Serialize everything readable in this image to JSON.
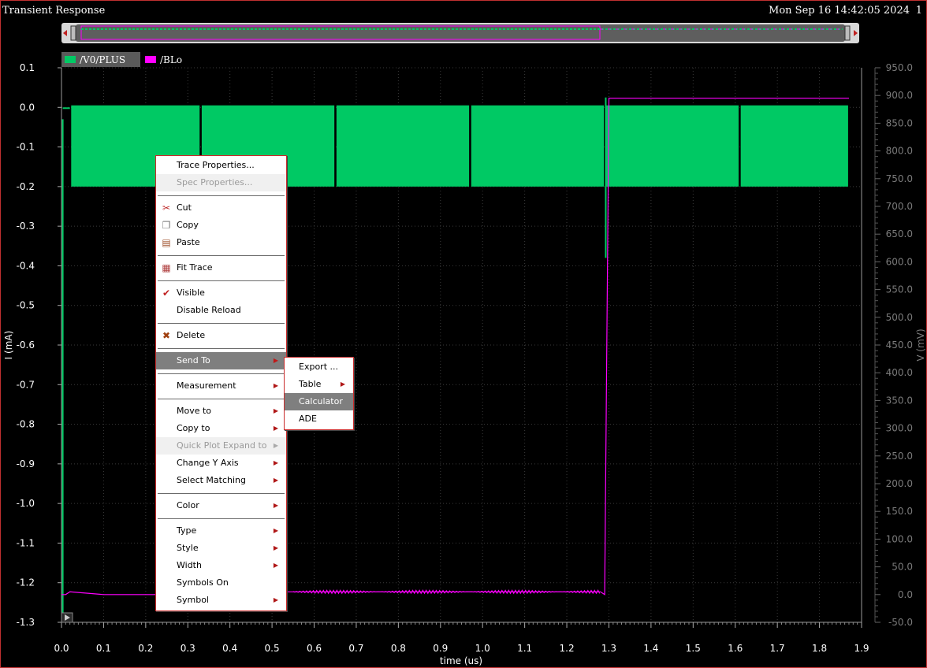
{
  "window": {
    "title": "Transient Response",
    "timestamp": "Mon Sep 16 14:42:05 2024",
    "page_number": "1"
  },
  "legend": [
    {
      "label": "/V0/PLUS",
      "color": "#00c964"
    },
    {
      "label": "/BLo",
      "color": "#ff00ff"
    }
  ],
  "context_menu": {
    "items": [
      {
        "label": "Trace Properties...",
        "kind": "item"
      },
      {
        "label": "Spec Properties...",
        "kind": "item",
        "disabled": true
      },
      {
        "kind": "sep"
      },
      {
        "label": "Cut",
        "kind": "item",
        "icon": "scissors-icon",
        "glyph": "✂"
      },
      {
        "label": "Copy",
        "kind": "item",
        "icon": "copy-icon",
        "glyph": "❐"
      },
      {
        "label": "Paste",
        "kind": "item",
        "icon": "paste-icon",
        "glyph": "▤"
      },
      {
        "kind": "sep"
      },
      {
        "label": "Fit Trace",
        "kind": "item",
        "icon": "fit-trace-icon",
        "glyph": "▦"
      },
      {
        "kind": "sep"
      },
      {
        "label": "Visible",
        "kind": "item",
        "icon": "checkmark-icon",
        "glyph": "✔"
      },
      {
        "label": "Disable Reload",
        "kind": "item"
      },
      {
        "kind": "sep"
      },
      {
        "label": "Delete",
        "kind": "item",
        "icon": "delete-x-icon",
        "glyph": "✖"
      },
      {
        "kind": "sep"
      },
      {
        "label": "Send To",
        "kind": "item",
        "submenu": true,
        "highlighted": true
      },
      {
        "kind": "sep"
      },
      {
        "label": "Measurement",
        "kind": "item",
        "submenu": true
      },
      {
        "kind": "sep"
      },
      {
        "label": "Move to",
        "kind": "item",
        "submenu": true
      },
      {
        "label": "Copy to",
        "kind": "item",
        "submenu": true
      },
      {
        "label": "Quick Plot Expand to",
        "kind": "item",
        "submenu": true,
        "disabled": true
      },
      {
        "label": "Change Y Axis",
        "kind": "item",
        "submenu": true
      },
      {
        "label": "Select Matching",
        "kind": "item",
        "submenu": true
      },
      {
        "kind": "sep"
      },
      {
        "label": "Color",
        "kind": "item",
        "submenu": true
      },
      {
        "kind": "sep"
      },
      {
        "label": "Type",
        "kind": "item",
        "submenu": true
      },
      {
        "label": "Style",
        "kind": "item",
        "submenu": true
      },
      {
        "label": "Width",
        "kind": "item",
        "submenu": true
      },
      {
        "label": "Symbols On",
        "kind": "item"
      },
      {
        "label": "Symbol",
        "kind": "item",
        "submenu": true
      }
    ]
  },
  "send_to_submenu": {
    "items": [
      {
        "label": "Export ...",
        "submenu": false
      },
      {
        "label": "Table",
        "submenu": true
      },
      {
        "label": "Calculator",
        "submenu": false,
        "highlighted": true
      },
      {
        "label": "ADE",
        "submenu": false
      }
    ]
  },
  "chart_data": {
    "type": "line",
    "xlabel": "time (us)",
    "ylabel_left": "I (mA)",
    "ylabel_right": "V (mV)",
    "x_ticks": [
      "0.0",
      "0.1",
      "0.2",
      "0.3",
      "0.4",
      "0.5",
      "0.6",
      "0.7",
      "0.8",
      "0.9",
      "1.0",
      "1.1",
      "1.2",
      "1.3",
      "1.4",
      "1.5",
      "1.6",
      "1.7",
      "1.8",
      "1.9"
    ],
    "y_left_ticks": [
      "0.1",
      "0.0",
      "-0.1",
      "-0.2",
      "-0.3",
      "-0.4",
      "-0.5",
      "-0.6",
      "-0.7",
      "-0.8",
      "-0.9",
      "-1.0",
      "-1.1",
      "-1.2",
      "-1.3"
    ],
    "y_right_ticks": [
      "950.0",
      "900.0",
      "850.0",
      "800.0",
      "750.0",
      "700.0",
      "650.0",
      "600.0",
      "550.0",
      "500.0",
      "450.0",
      "400.0",
      "350.0",
      "300.0",
      "250.0",
      "200.0",
      "150.0",
      "100.0",
      "50.0",
      "0.0",
      "-50.0"
    ],
    "xlim": [
      0,
      1.9
    ],
    "ylim_left": [
      -1.3,
      0.1
    ],
    "ylim_right": [
      -50,
      950
    ],
    "series": [
      {
        "name": "/V0/PLUS",
        "axis": "left",
        "color": "#00c964",
        "description_points": {
          "x": [
            0.0,
            0.005,
            0.01,
            0.02,
            1.87
          ],
          "y_top": [
            -1.3,
            0.0,
            0.0,
            0.005,
            0.005
          ],
          "y_bottom": [
            -1.3,
            -1.2,
            -0.2,
            -0.2,
            -0.2
          ]
        },
        "segment_boundaries": [
          0.02,
          0.33,
          0.65,
          0.97,
          1.29,
          1.61
        ],
        "oscillation_band": [
          -0.2,
          0.005
        ]
      },
      {
        "name": "/BLo",
        "axis": "right",
        "color": "#ff00ff",
        "x": [
          0.0,
          0.005,
          0.01,
          0.02,
          0.1,
          0.3,
          0.5,
          0.7,
          0.9,
          1.1,
          1.28,
          1.29,
          1.295,
          1.3,
          1.87
        ],
        "y": [
          0,
          0,
          0,
          5,
          0,
          0,
          5,
          5,
          5,
          5,
          5,
          0,
          450,
          895,
          895
        ]
      }
    ]
  }
}
